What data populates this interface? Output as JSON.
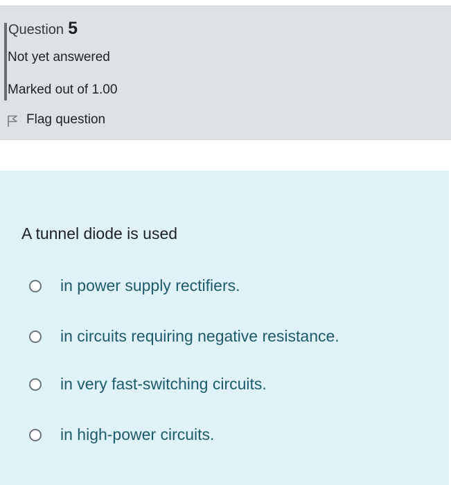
{
  "info": {
    "question_word": "Question",
    "question_number": "5",
    "state": "Not yet answered",
    "grade": "Marked out of 1.00",
    "flag_label": "Flag question",
    "flag_icon": "flag-icon"
  },
  "question": {
    "text": "A tunnel diode is used",
    "answers": [
      {
        "label": "in power supply rectifiers.",
        "selected": false
      },
      {
        "label": "in circuits requiring negative resistance.",
        "selected": false
      },
      {
        "label": "in very fast-switching circuits.",
        "selected": false
      },
      {
        "label": "in high-power circuits.",
        "selected": false
      }
    ]
  },
  "colors": {
    "info_background": "#dee2e6",
    "content_background": "#def2f8",
    "answer_text": "#1f5a6b",
    "accent_bar": "#6a6d70"
  }
}
